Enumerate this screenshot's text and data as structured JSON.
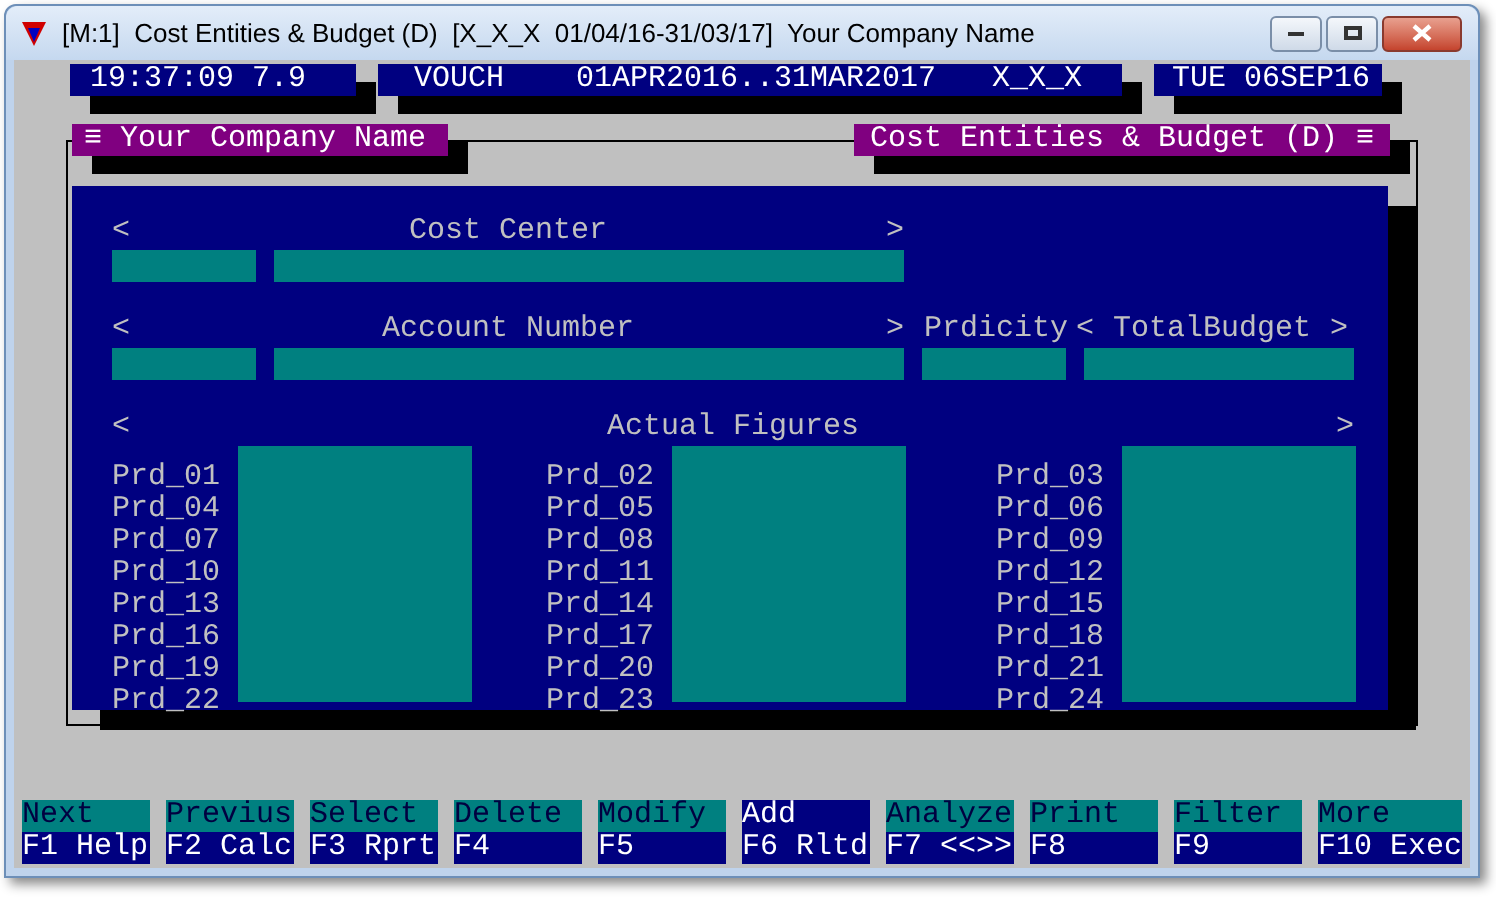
{
  "window": {
    "title": "[M:1]  Cost Entities & Budget (D)  [X_X_X  01/04/16-31/03/17]  Your Company Name"
  },
  "status": {
    "clock": "19:37:09 7.9",
    "mode": "VOUCH",
    "range": "01APR2016..31MAR2017",
    "company_code": "X_X_X",
    "date": "TUE 06SEP16"
  },
  "tabs": {
    "left": "≡ Your Company Name",
    "right": "Cost Entities & Budget (D) ≡"
  },
  "cost_center": {
    "open": "<",
    "label": "Cost Center",
    "close": ">"
  },
  "account": {
    "open": "<",
    "label": "Account Number",
    "close": ">"
  },
  "periodicity": {
    "label": "Prdicity"
  },
  "total_budget": {
    "open": "<",
    "label": "TotalBudget",
    "close": ">"
  },
  "actual_figures": {
    "open": "<",
    "label": "Actual Figures",
    "close": ">",
    "columns": [
      {
        "periods": [
          "Prd_01",
          "Prd_04",
          "Prd_07",
          "Prd_10",
          "Prd_13",
          "Prd_16",
          "Prd_19",
          "Prd_22"
        ]
      },
      {
        "periods": [
          "Prd_02",
          "Prd_05",
          "Prd_08",
          "Prd_11",
          "Prd_14",
          "Prd_17",
          "Prd_20",
          "Prd_23"
        ]
      },
      {
        "periods": [
          "Prd_03",
          "Prd_06",
          "Prd_09",
          "Prd_12",
          "Prd_15",
          "Prd_18",
          "Prd_21",
          "Prd_24"
        ]
      }
    ]
  },
  "function_keys": [
    {
      "top": "Next",
      "bottom": "F1 Help",
      "selected": false
    },
    {
      "top": "Previus",
      "bottom": "F2 Calc",
      "selected": false
    },
    {
      "top": "Select",
      "bottom": "F3 Rprt",
      "selected": false
    },
    {
      "top": "Delete",
      "bottom": "F4",
      "selected": false
    },
    {
      "top": "Modify",
      "bottom": "F5",
      "selected": false
    },
    {
      "top": "Add",
      "bottom": "F6 Rltd",
      "selected": true
    },
    {
      "top": "Analyze",
      "bottom": "F7 <<>>",
      "selected": false
    },
    {
      "top": "Print",
      "bottom": "F8",
      "selected": false
    },
    {
      "top": "Filter",
      "bottom": "F9",
      "selected": false
    },
    {
      "top": "More",
      "bottom": "F10 Exec",
      "selected": false
    }
  ]
}
